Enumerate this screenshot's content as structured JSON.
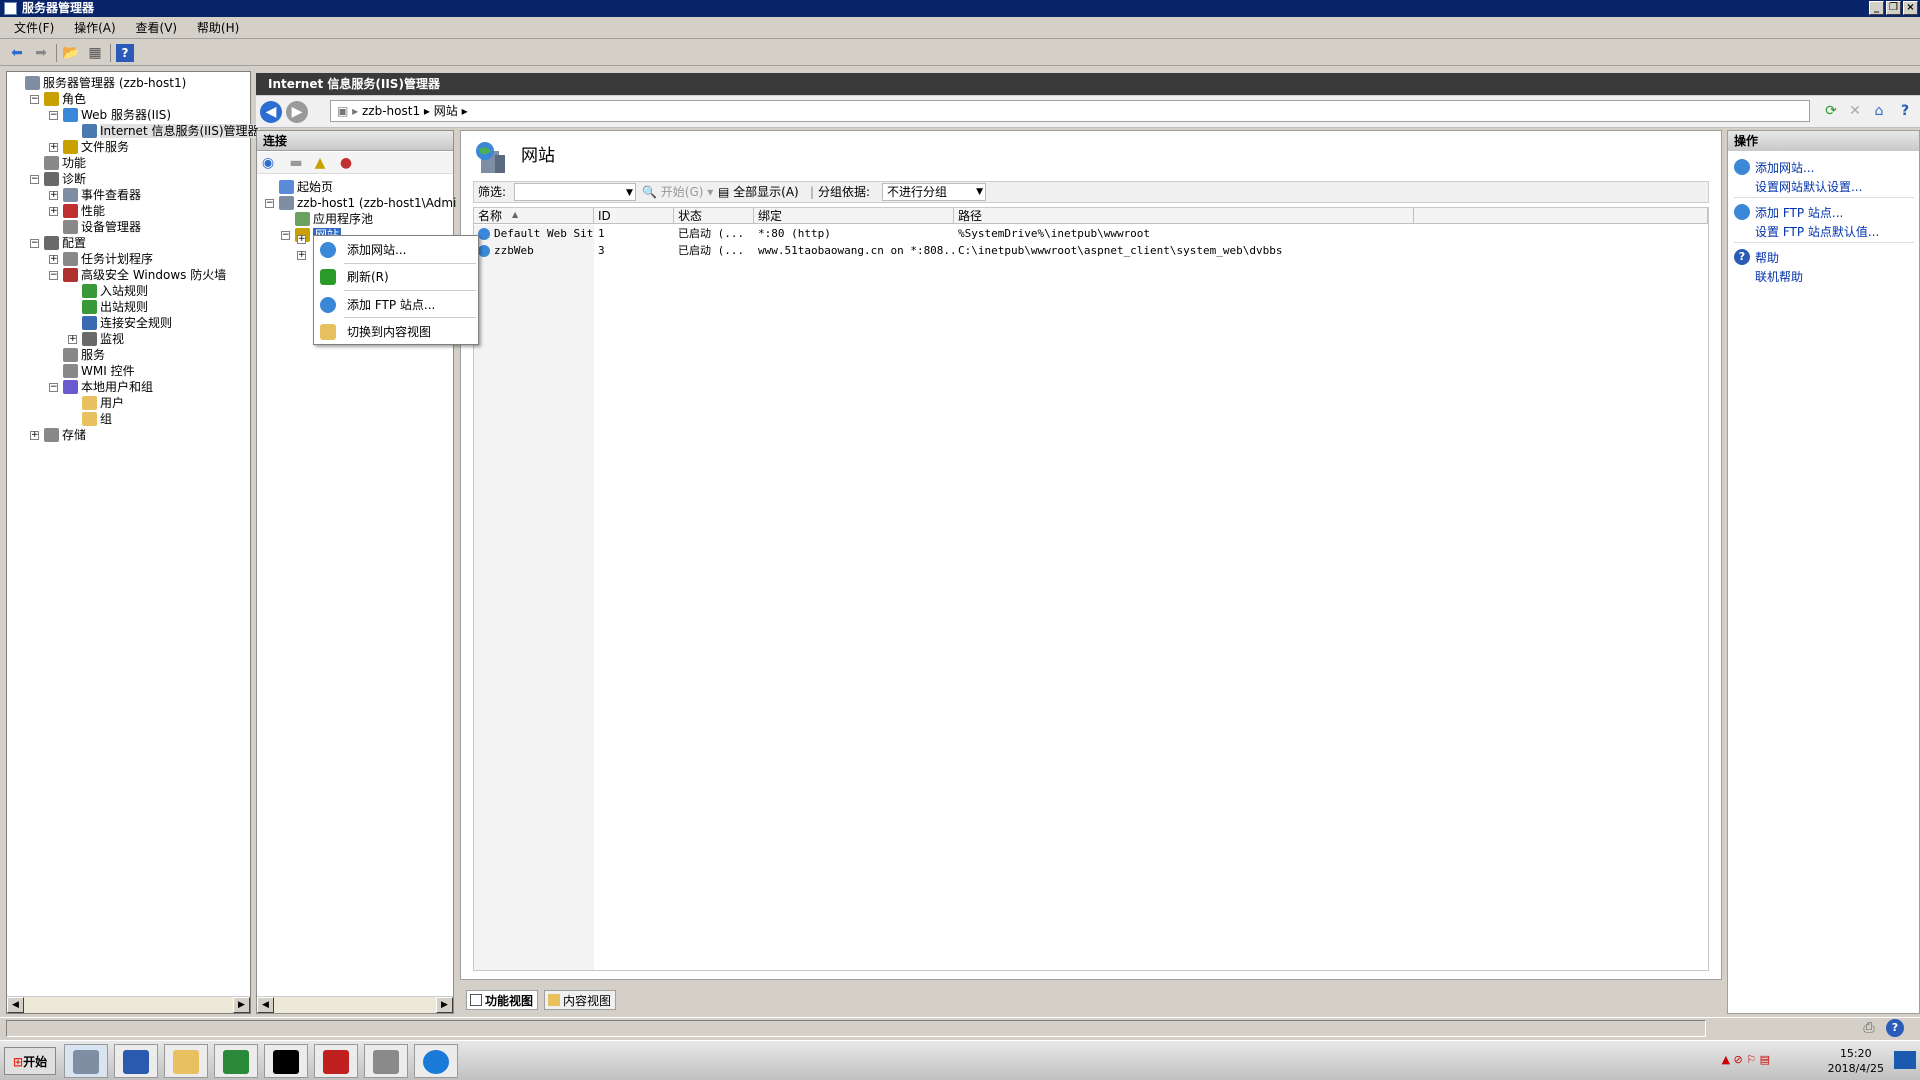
{
  "window": {
    "title": "服务器管理器"
  },
  "menu": [
    "文件(F)",
    "操作(A)",
    "查看(V)",
    "帮助(H)"
  ],
  "left_tree": [
    {
      "label": "服务器管理器 (zzb-host1)",
      "indent": 0,
      "exp": ""
    },
    {
      "label": "角色",
      "indent": 1,
      "exp": "−"
    },
    {
      "label": "Web 服务器(IIS)",
      "indent": 2,
      "exp": "−"
    },
    {
      "label": "Internet 信息服务(IIS)管理器",
      "indent": 3,
      "exp": "",
      "selected": true
    },
    {
      "label": "文件服务",
      "indent": 2,
      "exp": "+"
    },
    {
      "label": "功能",
      "indent": 1,
      "exp": ""
    },
    {
      "label": "诊断",
      "indent": 1,
      "exp": "−"
    },
    {
      "label": "事件查看器",
      "indent": 2,
      "exp": "+"
    },
    {
      "label": "性能",
      "indent": 2,
      "exp": "+"
    },
    {
      "label": "设备管理器",
      "indent": 2,
      "exp": ""
    },
    {
      "label": "配置",
      "indent": 1,
      "exp": "−"
    },
    {
      "label": "任务计划程序",
      "indent": 2,
      "exp": "+"
    },
    {
      "label": "高级安全 Windows 防火墙",
      "indent": 2,
      "exp": "−"
    },
    {
      "label": "入站规则",
      "indent": 3,
      "exp": ""
    },
    {
      "label": "出站规则",
      "indent": 3,
      "exp": ""
    },
    {
      "label": "连接安全规则",
      "indent": 3,
      "exp": ""
    },
    {
      "label": "监视",
      "indent": 3,
      "exp": "+"
    },
    {
      "label": "服务",
      "indent": 2,
      "exp": ""
    },
    {
      "label": "WMI 控件",
      "indent": 2,
      "exp": ""
    },
    {
      "label": "本地用户和组",
      "indent": 2,
      "exp": "−"
    },
    {
      "label": "用户",
      "indent": 3,
      "exp": ""
    },
    {
      "label": "组",
      "indent": 3,
      "exp": ""
    },
    {
      "label": "存储",
      "indent": 1,
      "exp": "+"
    }
  ],
  "iis": {
    "header": "Internet 信息服务(IIS)管理器",
    "breadcrumb": [
      "zzb-host1",
      "网站"
    ]
  },
  "connections": {
    "title": "连接",
    "tree": [
      {
        "label": "起始页",
        "indent": 0,
        "exp": ""
      },
      {
        "label": "zzb-host1 (zzb-host1\\Admi",
        "indent": 0,
        "exp": "−"
      },
      {
        "label": "应用程序池",
        "indent": 1,
        "exp": ""
      },
      {
        "label": "网站",
        "indent": 1,
        "exp": "−",
        "selected": true
      }
    ]
  },
  "context_menu": [
    "添加网站...",
    "刷新(R)",
    "添加 FTP 站点...",
    "切换到内容视图"
  ],
  "main": {
    "title": "网站",
    "filter_label": "筛选:",
    "start_label": "开始(G)",
    "show_all_label": "全部显示(A)",
    "group_label": "分组依据:",
    "group_value": "不进行分组",
    "columns": [
      "名称",
      "ID",
      "状态",
      "绑定",
      "路径"
    ],
    "rows": [
      [
        "Default Web Site",
        "1",
        "已启动 (...",
        "*:80 (http)",
        "%SystemDrive%\\inetpub\\wwwroot"
      ],
      [
        "zzbWeb",
        "3",
        "已启动 (...",
        "www.51taobaowang.cn on *:808...",
        "C:\\inetpub\\wwwroot\\aspnet_client\\system_web\\dvbbs"
      ]
    ]
  },
  "view_tabs": [
    "功能视图",
    "内容视图"
  ],
  "actions": {
    "title": "操作",
    "items": [
      "添加网站...",
      "设置网站默认设置...",
      "添加 FTP 站点...",
      "设置 FTP 站点默认值...",
      "帮助",
      "联机帮助"
    ]
  },
  "taskbar": {
    "start": "开始",
    "time": "15:20",
    "date": "2018/4/25"
  },
  "colors": {
    "titlebar": "#0a246a",
    "iis_header": "#3a3a3a",
    "link": "#0033aa",
    "selection": "#316ac5"
  }
}
